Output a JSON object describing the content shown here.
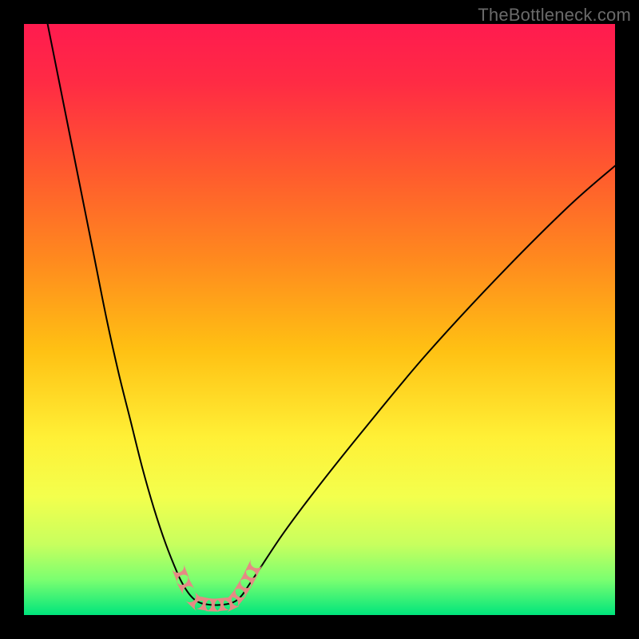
{
  "watermark": "TheBottleneck.com",
  "colors": {
    "frame": "#000000",
    "gradient_stops": [
      {
        "offset": 0.0,
        "color": "#ff1b4f"
      },
      {
        "offset": 0.1,
        "color": "#ff2b44"
      },
      {
        "offset": 0.25,
        "color": "#ff5a2e"
      },
      {
        "offset": 0.4,
        "color": "#ff8a1e"
      },
      {
        "offset": 0.55,
        "color": "#ffc013"
      },
      {
        "offset": 0.7,
        "color": "#fff036"
      },
      {
        "offset": 0.8,
        "color": "#f3ff4d"
      },
      {
        "offset": 0.88,
        "color": "#c8ff5e"
      },
      {
        "offset": 0.94,
        "color": "#7bff70"
      },
      {
        "offset": 1.0,
        "color": "#00e57c"
      }
    ],
    "curve": "#000000",
    "marker_fill": "#e58a84",
    "marker_stroke": "#d46a63"
  },
  "chart_data": {
    "type": "line",
    "title": "",
    "xlabel": "",
    "ylabel": "",
    "xlim": [
      0,
      100
    ],
    "ylim": [
      0,
      100
    ],
    "grid": false,
    "legend": false,
    "series": [
      {
        "name": "bottleneck-curve-left",
        "x": [
          4,
          6,
          8,
          10,
          12,
          14,
          16,
          18,
          20,
          22,
          24,
          26,
          27,
          28,
          29,
          30
        ],
        "y": [
          100,
          90,
          80,
          70,
          60,
          50,
          41,
          33,
          25,
          18,
          12,
          7,
          5,
          3.5,
          2.5,
          2
        ]
      },
      {
        "name": "bottleneck-curve-right",
        "x": [
          35,
          36,
          37,
          38,
          40,
          44,
          50,
          58,
          68,
          80,
          92,
          100
        ],
        "y": [
          2,
          2.5,
          3.5,
          5,
          8,
          14,
          22,
          32,
          44,
          57,
          69,
          76
        ]
      },
      {
        "name": "bottleneck-floor",
        "x": [
          30,
          31,
          32,
          33,
          34,
          35
        ],
        "y": [
          2,
          1.8,
          1.7,
          1.7,
          1.8,
          2
        ]
      }
    ],
    "markers": {
      "name": "highlight-points",
      "points": [
        {
          "x": 26.5,
          "y": 7.0
        },
        {
          "x": 27.3,
          "y": 5.0
        },
        {
          "x": 29.0,
          "y": 2.3
        },
        {
          "x": 30.5,
          "y": 1.9
        },
        {
          "x": 32.0,
          "y": 1.7
        },
        {
          "x": 33.5,
          "y": 1.8
        },
        {
          "x": 35.0,
          "y": 2.0
        },
        {
          "x": 36.0,
          "y": 3.0
        },
        {
          "x": 37.0,
          "y": 4.5
        },
        {
          "x": 38.0,
          "y": 6.2
        },
        {
          "x": 38.8,
          "y": 7.8
        }
      ]
    }
  }
}
